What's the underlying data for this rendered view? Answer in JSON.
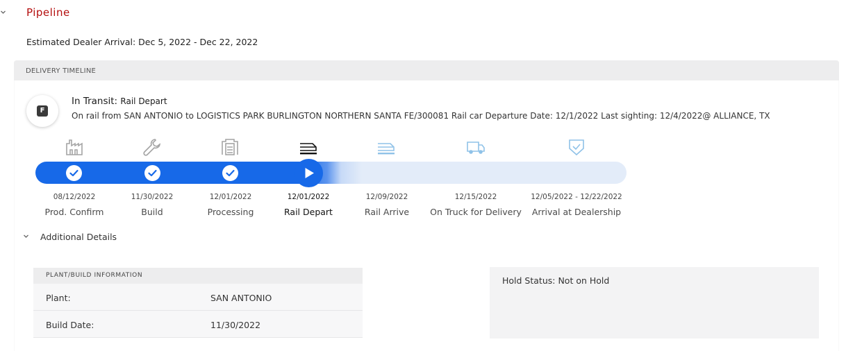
{
  "pipeline": {
    "title": "Pipeline",
    "eta": "Estimated Dealer Arrival: Dec 5, 2022 - Dec 22, 2022"
  },
  "timeline": {
    "header": "DELIVERY TIMELINE",
    "avatar_letter": "F",
    "status_prefix": "In Transit:",
    "status_sub": "Rail Depart",
    "status_detail": "On rail from SAN ANTONIO to LOGISTICS PARK BURLINGTON NORTHERN SANTA FE/300081 Rail car Departure Date: 12/1/2022 Last sighting: 12/4/2022@ ALLIANCE, TX",
    "progress_fraction": 0.52,
    "colors": {
      "complete": "#1769e8",
      "pending": "#e3ecf9",
      "pending_icon": "#8fc2e8",
      "done_icon": "#9a9a9a"
    },
    "steps": [
      {
        "date": "08/12/2022",
        "label": "Prod. Confirm",
        "icon": "factory-icon",
        "state": "done"
      },
      {
        "date": "11/30/2022",
        "label": "Build",
        "icon": "wrench-icon",
        "state": "done"
      },
      {
        "date": "12/01/2022",
        "label": "Processing",
        "icon": "processing-icon",
        "state": "done"
      },
      {
        "date": "12/01/2022",
        "label": "Rail Depart",
        "icon": "train-icon",
        "state": "current"
      },
      {
        "date": "12/09/2022",
        "label": "Rail Arrive",
        "icon": "train-icon",
        "state": "pending"
      },
      {
        "date": "12/15/2022",
        "label": "On Truck for Delivery",
        "icon": "truck-icon",
        "state": "pending"
      },
      {
        "date": "12/05/2022 - 12/22/2022",
        "label": "Arrival at Dealership",
        "icon": "shield-check-icon",
        "state": "pending"
      }
    ]
  },
  "details": {
    "toggle_label": "Additional Details",
    "plant_header": "PLANT/BUILD INFORMATION",
    "rows": [
      {
        "key": "Plant:",
        "value": "SAN ANTONIO"
      },
      {
        "key": "Build Date:",
        "value": "11/30/2022"
      }
    ],
    "hold_status": "Hold Status: Not on Hold"
  }
}
